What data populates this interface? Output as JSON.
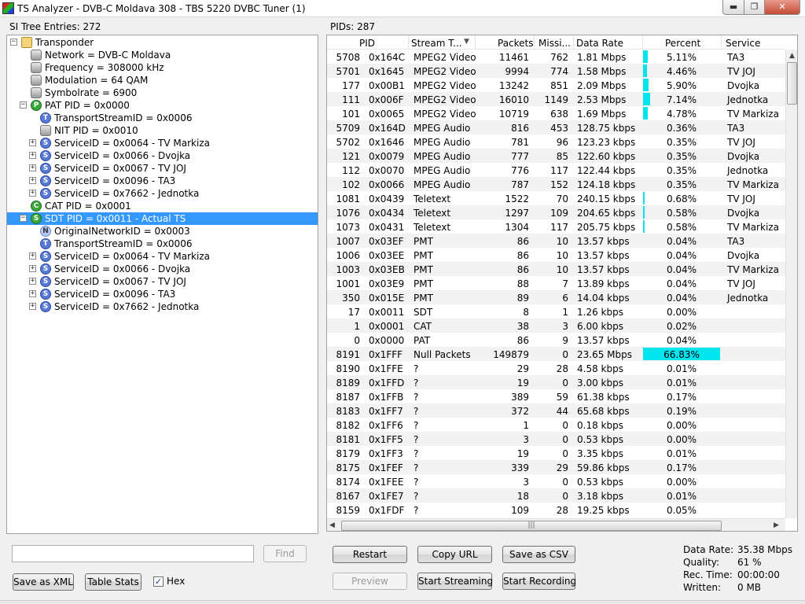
{
  "window": {
    "title": "TS Analyzer - DVB-C Moldava 308 - TBS 5220 DVBC Tuner (1)"
  },
  "tree": {
    "header": "SI Tree Entries: 272",
    "items": [
      {
        "text": "Transponder",
        "icon": "folder",
        "glyph": "",
        "toggle": "−",
        "depth": 0
      },
      {
        "text": "Network = DVB-C Moldava",
        "icon": "prop",
        "glyph": "",
        "toggle": "",
        "depth": 1
      },
      {
        "text": "Frequency = 308000 kHz",
        "icon": "prop",
        "glyph": "",
        "toggle": "",
        "depth": 1
      },
      {
        "text": "Modulation = 64 QAM",
        "icon": "prop",
        "glyph": "",
        "toggle": "",
        "depth": 1
      },
      {
        "text": "Symbolrate = 6900",
        "icon": "prop",
        "glyph": "",
        "toggle": "",
        "depth": 1
      },
      {
        "text": "PAT PID = 0x0000",
        "icon": "P",
        "glyph": "P",
        "toggle": "−",
        "depth": 1
      },
      {
        "text": "TransportStreamID = 0x0006",
        "icon": "T",
        "glyph": "T",
        "toggle": "",
        "depth": 2
      },
      {
        "text": "NIT PID = 0x0010",
        "icon": "prop",
        "glyph": "",
        "toggle": "",
        "depth": 2
      },
      {
        "text": "ServiceID = 0x0064 - TV Markiza",
        "icon": "S",
        "glyph": "S",
        "toggle": "+",
        "depth": 2
      },
      {
        "text": "ServiceID = 0x0066 - Dvojka",
        "icon": "S",
        "glyph": "S",
        "toggle": "+",
        "depth": 2
      },
      {
        "text": "ServiceID = 0x0067 - TV JOJ",
        "icon": "S",
        "glyph": "S",
        "toggle": "+",
        "depth": 2
      },
      {
        "text": "ServiceID = 0x0096 - TA3",
        "icon": "S",
        "glyph": "S",
        "toggle": "+",
        "depth": 2
      },
      {
        "text": "ServiceID = 0x7662 - Jednotka",
        "icon": "S",
        "glyph": "S",
        "toggle": "+",
        "depth": 2
      },
      {
        "text": "CAT PID = 0x0001",
        "icon": "C",
        "glyph": "C",
        "toggle": "",
        "depth": 1
      },
      {
        "text": "SDT PID = 0x0011 - Actual TS",
        "icon": "Sg",
        "glyph": "S",
        "toggle": "−",
        "depth": 1,
        "selected": true
      },
      {
        "text": "OriginalNetworkID = 0x0003",
        "icon": "N",
        "glyph": "N",
        "toggle": "",
        "depth": 2
      },
      {
        "text": "TransportStreamID = 0x0006",
        "icon": "T",
        "glyph": "T",
        "toggle": "",
        "depth": 2
      },
      {
        "text": "ServiceID = 0x0064 - TV Markiza",
        "icon": "S",
        "glyph": "S",
        "toggle": "+",
        "depth": 2
      },
      {
        "text": "ServiceID = 0x0066 - Dvojka",
        "icon": "S",
        "glyph": "S",
        "toggle": "+",
        "depth": 2
      },
      {
        "text": "ServiceID = 0x0067 - TV JOJ",
        "icon": "S",
        "glyph": "S",
        "toggle": "+",
        "depth": 2
      },
      {
        "text": "ServiceID = 0x0096 - TA3",
        "icon": "S",
        "glyph": "S",
        "toggle": "+",
        "depth": 2
      },
      {
        "text": "ServiceID = 0x7662 - Jednotka",
        "icon": "S",
        "glyph": "S",
        "toggle": "+",
        "depth": 2
      }
    ]
  },
  "pids": {
    "header": "PIDs: 287",
    "columns": [
      "PID",
      "Stream T...",
      "Packets",
      "Missi...",
      "Data Rate",
      "Percent",
      "Service"
    ],
    "rows": [
      {
        "pid": "5708",
        "hex": "0x164C",
        "type": "MPEG2 Video",
        "packets": "11461",
        "missing": "762",
        "rate": "1.81 Mbps",
        "pct": "5.11%",
        "pct_value": 5.11,
        "service": "TA3"
      },
      {
        "pid": "5701",
        "hex": "0x1645",
        "type": "MPEG2 Video",
        "packets": "9994",
        "missing": "774",
        "rate": "1.58 Mbps",
        "pct": "4.46%",
        "pct_value": 4.46,
        "service": "TV JOJ"
      },
      {
        "pid": "177",
        "hex": "0x00B1",
        "type": "MPEG2 Video",
        "packets": "13242",
        "missing": "851",
        "rate": "2.09 Mbps",
        "pct": "5.90%",
        "pct_value": 5.9,
        "service": "Dvojka"
      },
      {
        "pid": "111",
        "hex": "0x006F",
        "type": "MPEG2 Video",
        "packets": "16010",
        "missing": "1149",
        "rate": "2.53 Mbps",
        "pct": "7.14%",
        "pct_value": 7.14,
        "service": "Jednotka"
      },
      {
        "pid": "101",
        "hex": "0x0065",
        "type": "MPEG2 Video",
        "packets": "10719",
        "missing": "638",
        "rate": "1.69 Mbps",
        "pct": "4.78%",
        "pct_value": 4.78,
        "service": "TV Markiza"
      },
      {
        "pid": "5709",
        "hex": "0x164D",
        "type": "MPEG Audio",
        "packets": "816",
        "missing": "453",
        "rate": "128.75 kbps",
        "pct": "0.36%",
        "pct_value": 0.36,
        "service": "TA3"
      },
      {
        "pid": "5702",
        "hex": "0x1646",
        "type": "MPEG Audio",
        "packets": "781",
        "missing": "96",
        "rate": "123.23 kbps",
        "pct": "0.35%",
        "pct_value": 0.35,
        "service": "TV JOJ"
      },
      {
        "pid": "121",
        "hex": "0x0079",
        "type": "MPEG Audio",
        "packets": "777",
        "missing": "85",
        "rate": "122.60 kbps",
        "pct": "0.35%",
        "pct_value": 0.35,
        "service": "Dvojka"
      },
      {
        "pid": "112",
        "hex": "0x0070",
        "type": "MPEG Audio",
        "packets": "776",
        "missing": "117",
        "rate": "122.44 kbps",
        "pct": "0.35%",
        "pct_value": 0.35,
        "service": "Jednotka"
      },
      {
        "pid": "102",
        "hex": "0x0066",
        "type": "MPEG Audio",
        "packets": "787",
        "missing": "152",
        "rate": "124.18 kbps",
        "pct": "0.35%",
        "pct_value": 0.35,
        "service": "TV Markiza"
      },
      {
        "pid": "1081",
        "hex": "0x0439",
        "type": "Teletext",
        "packets": "1522",
        "missing": "70",
        "rate": "240.15 kbps",
        "pct": "0.68%",
        "pct_value": 0.68,
        "service": "TV JOJ"
      },
      {
        "pid": "1076",
        "hex": "0x0434",
        "type": "Teletext",
        "packets": "1297",
        "missing": "109",
        "rate": "204.65 kbps",
        "pct": "0.58%",
        "pct_value": 0.58,
        "service": "Dvojka"
      },
      {
        "pid": "1073",
        "hex": "0x0431",
        "type": "Teletext",
        "packets": "1304",
        "missing": "117",
        "rate": "205.75 kbps",
        "pct": "0.58%",
        "pct_value": 0.58,
        "service": "TV Markiza"
      },
      {
        "pid": "1007",
        "hex": "0x03EF",
        "type": "PMT",
        "packets": "86",
        "missing": "10",
        "rate": "13.57 kbps",
        "pct": "0.04%",
        "pct_value": 0.04,
        "service": "TA3"
      },
      {
        "pid": "1006",
        "hex": "0x03EE",
        "type": "PMT",
        "packets": "86",
        "missing": "10",
        "rate": "13.57 kbps",
        "pct": "0.04%",
        "pct_value": 0.04,
        "service": "Dvojka"
      },
      {
        "pid": "1003",
        "hex": "0x03EB",
        "type": "PMT",
        "packets": "86",
        "missing": "10",
        "rate": "13.57 kbps",
        "pct": "0.04%",
        "pct_value": 0.04,
        "service": "TV Markiza"
      },
      {
        "pid": "1001",
        "hex": "0x03E9",
        "type": "PMT",
        "packets": "88",
        "missing": "7",
        "rate": "13.89 kbps",
        "pct": "0.04%",
        "pct_value": 0.04,
        "service": "TV JOJ"
      },
      {
        "pid": "350",
        "hex": "0x015E",
        "type": "PMT",
        "packets": "89",
        "missing": "6",
        "rate": "14.04 kbps",
        "pct": "0.04%",
        "pct_value": 0.04,
        "service": "Jednotka"
      },
      {
        "pid": "17",
        "hex": "0x0011",
        "type": "SDT",
        "packets": "8",
        "missing": "1",
        "rate": "1.26 kbps",
        "pct": "0.00%",
        "pct_value": 0.0,
        "service": ""
      },
      {
        "pid": "1",
        "hex": "0x0001",
        "type": "CAT",
        "packets": "38",
        "missing": "3",
        "rate": "6.00 kbps",
        "pct": "0.02%",
        "pct_value": 0.02,
        "service": ""
      },
      {
        "pid": "0",
        "hex": "0x0000",
        "type": "PAT",
        "packets": "86",
        "missing": "9",
        "rate": "13.57 kbps",
        "pct": "0.04%",
        "pct_value": 0.04,
        "service": ""
      },
      {
        "pid": "8191",
        "hex": "0x1FFF",
        "type": "Null Packets",
        "packets": "149879",
        "missing": "0",
        "rate": "23.65 Mbps",
        "pct": "66.83%",
        "pct_value": 66.83,
        "service": ""
      },
      {
        "pid": "8190",
        "hex": "0x1FFE",
        "type": "?",
        "packets": "29",
        "missing": "28",
        "rate": "4.58 kbps",
        "pct": "0.01%",
        "pct_value": 0.01,
        "service": ""
      },
      {
        "pid": "8189",
        "hex": "0x1FFD",
        "type": "?",
        "packets": "19",
        "missing": "0",
        "rate": "3.00 kbps",
        "pct": "0.01%",
        "pct_value": 0.01,
        "service": ""
      },
      {
        "pid": "8187",
        "hex": "0x1FFB",
        "type": "?",
        "packets": "389",
        "missing": "59",
        "rate": "61.38 kbps",
        "pct": "0.17%",
        "pct_value": 0.17,
        "service": ""
      },
      {
        "pid": "8183",
        "hex": "0x1FF7",
        "type": "?",
        "packets": "372",
        "missing": "44",
        "rate": "65.68 kbps",
        "pct": "0.19%",
        "pct_value": 0.19,
        "service": ""
      },
      {
        "pid": "8182",
        "hex": "0x1FF6",
        "type": "?",
        "packets": "1",
        "missing": "0",
        "rate": "0.18 kbps",
        "pct": "0.00%",
        "pct_value": 0.0,
        "service": ""
      },
      {
        "pid": "8181",
        "hex": "0x1FF5",
        "type": "?",
        "packets": "3",
        "missing": "0",
        "rate": "0.53 kbps",
        "pct": "0.00%",
        "pct_value": 0.0,
        "service": ""
      },
      {
        "pid": "8179",
        "hex": "0x1FF3",
        "type": "?",
        "packets": "19",
        "missing": "0",
        "rate": "3.35 kbps",
        "pct": "0.01%",
        "pct_value": 0.01,
        "service": ""
      },
      {
        "pid": "8175",
        "hex": "0x1FEF",
        "type": "?",
        "packets": "339",
        "missing": "29",
        "rate": "59.86 kbps",
        "pct": "0.17%",
        "pct_value": 0.17,
        "service": ""
      },
      {
        "pid": "8174",
        "hex": "0x1FEE",
        "type": "?",
        "packets": "3",
        "missing": "0",
        "rate": "0.53 kbps",
        "pct": "0.00%",
        "pct_value": 0.0,
        "service": ""
      },
      {
        "pid": "8167",
        "hex": "0x1FE7",
        "type": "?",
        "packets": "18",
        "missing": "0",
        "rate": "3.18 kbps",
        "pct": "0.01%",
        "pct_value": 0.01,
        "service": ""
      },
      {
        "pid": "8159",
        "hex": "0x1FDF",
        "type": "?",
        "packets": "109",
        "missing": "28",
        "rate": "19.25 kbps",
        "pct": "0.05%",
        "pct_value": 0.05,
        "service": ""
      }
    ]
  },
  "search": {
    "value": "",
    "find_label": "Find"
  },
  "left_buttons": {
    "save_xml": "Save as XML",
    "table_stats": "Table Stats",
    "hex_label": "Hex",
    "hex_checked": true
  },
  "buttons": {
    "restart": "Restart",
    "copy_url": "Copy URL",
    "save_csv": "Save as CSV",
    "preview": "Preview",
    "start_streaming": "Start Streaming",
    "start_recording": "Start Recording"
  },
  "stats": {
    "data_rate_label": "Data Rate:",
    "data_rate_value": "35.38 Mbps",
    "quality_label": "Quality:",
    "quality_value": "61 %",
    "rec_time_label": "Rec. Time:",
    "rec_time_value": "00:00:00",
    "written_label": "Written:",
    "written_value": "0 MB"
  },
  "colors": {
    "selection": "#3399ff",
    "percent_bar": "#00e5ee"
  }
}
